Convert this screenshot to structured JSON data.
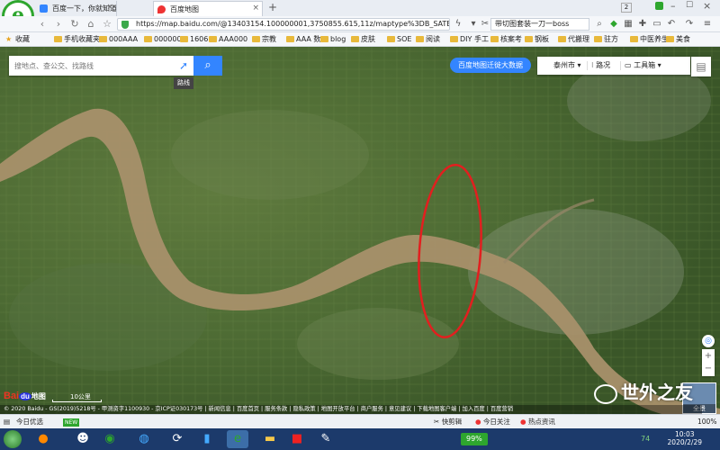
{
  "browser": {
    "tabs": [
      {
        "label": "百度一下，你就知道",
        "color": "#3385ff"
      },
      {
        "label": "百度地图",
        "color": "#e33"
      }
    ],
    "new_tab_symbol": "+",
    "url": "https://map.baidu.com/@13403154.100000001,3750855.615,11z/maptype%3DB_SATELLITE_",
    "search_text": "带切图套装一刀一boss",
    "badge_count": "2",
    "bookmarks": [
      {
        "label": "收藏",
        "icon": "star-icon"
      },
      {
        "label": "手机收藏夹"
      },
      {
        "label": "000AAA"
      },
      {
        "label": "000000"
      },
      {
        "label": "1606"
      },
      {
        "label": "AAA000"
      },
      {
        "label": "宗教"
      },
      {
        "label": "AAA 数"
      },
      {
        "label": "blog"
      },
      {
        "label": "皮肤"
      },
      {
        "label": "SOE"
      },
      {
        "label": "阅读"
      },
      {
        "label": "DIY 手工"
      },
      {
        "label": "核案考"
      },
      {
        "label": "钢板"
      },
      {
        "label": "代搬理"
      },
      {
        "label": "驻方"
      },
      {
        "label": "中医养生"
      },
      {
        "label": "美食"
      }
    ]
  },
  "map": {
    "search_placeholder": "搜地点、查公交、找路线",
    "route_tip": "路线",
    "migration_label": "百度地图迁徙大数据",
    "city": "泰州市",
    "traffic": "路况",
    "toolbox": "工具箱",
    "scale": "10公里",
    "baidu_logo": "Bai",
    "baidu_logo_du": "du",
    "baidu_logo_suffix": "地图",
    "copyright": "© 2020 Baidu - GS(2019)5218号 - 甲测资字1100930 - 京ICP证030173号 | 新闻信息 | 百度首页 | 服务条款 | 隐私政策 | 地图开放平台 | 商户服务 | 意见建议 | 下载地图客户端 | 加入百度 | 百度营销",
    "panorama_label": "全景",
    "watermark": "世外之友"
  },
  "statusbar": {
    "left": "今日优选",
    "left_badge": "NEW",
    "items": [
      "快剪辑",
      "今日关注",
      "热点资讯"
    ],
    "zoom": "100%"
  },
  "taskbar": {
    "battery": "99%",
    "time": "10:03",
    "date": "2020/2/29",
    "tray_number": "74"
  },
  "colors": {
    "accent": "#3385ff",
    "river": "#a8906a",
    "highlight_ellipse": "#e21f1f"
  }
}
